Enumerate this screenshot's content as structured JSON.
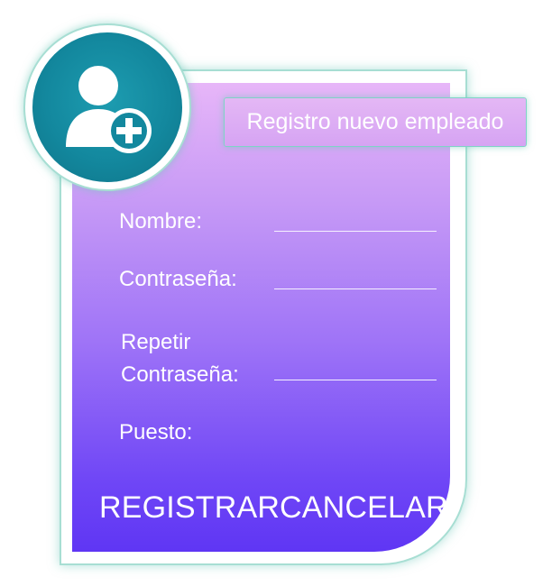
{
  "form": {
    "title": "Registro nuevo empleado",
    "fields": {
      "nombre_label": "Nombre:",
      "contrasena_label": "Contraseña:",
      "repetir_label_line1": "Repetir",
      "repetir_label_line2": "Contraseña:",
      "puesto_label": "Puesto:"
    },
    "buttons": {
      "register": "REGISTRAR",
      "cancel": "CANCELAR"
    }
  },
  "icons": {
    "avatar": "add-user-icon"
  },
  "colors": {
    "accent_teal": "#13889e",
    "border_glow": "#a7ded3",
    "gradient_top": "#e7b6f8",
    "gradient_bottom": "#5f36f4"
  }
}
